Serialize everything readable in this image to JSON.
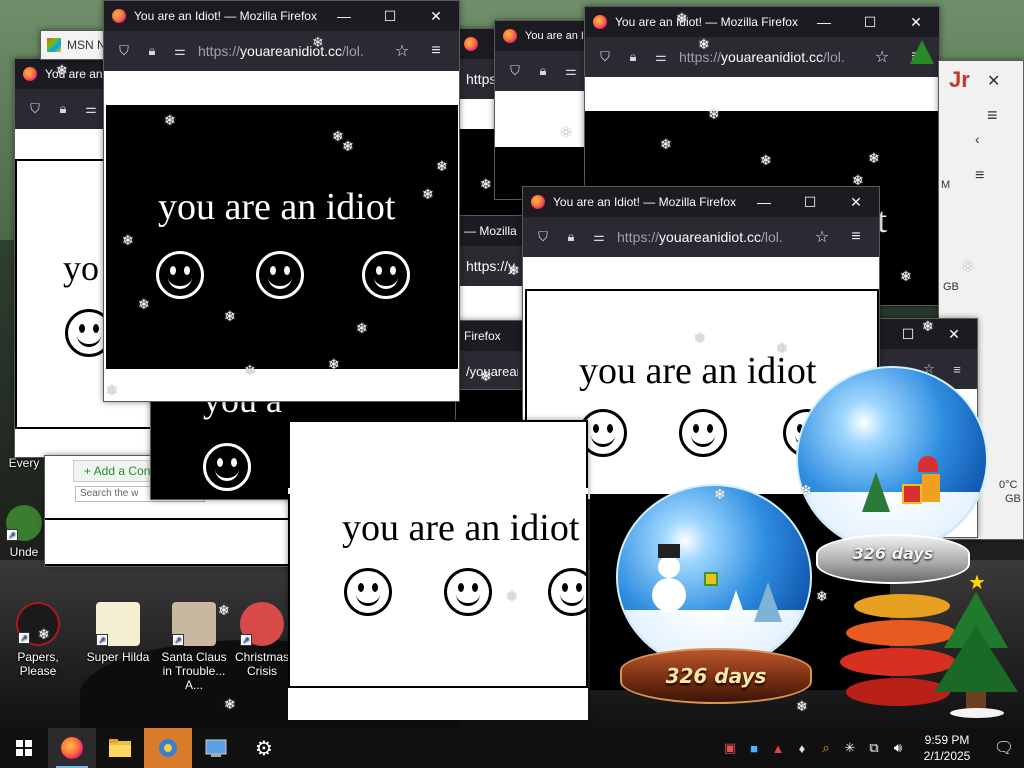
{
  "firefox_window": {
    "title": "You are an Idiot! — Mozilla Firefox",
    "url_prefix": "https://",
    "url_host": "youareanidiot.cc",
    "url_path": "/lol.",
    "minimize": "—",
    "maximize": "☐",
    "close": "✕",
    "icons": {
      "shield": "shield-icon",
      "lock": "lock-icon",
      "permissions": "permissions-icon",
      "star": "bookmark-star-icon",
      "menu": "hamburger-menu-icon"
    }
  },
  "page_content": {
    "headline": "you are an idiot",
    "headline_partial_1": "you a",
    "headline_partial_2": "yo",
    "headline_partial_3": "you are an idiot",
    "smiley": "smiley-face"
  },
  "partial_windows": {
    "tab_mozilla": "— Mozilla",
    "url_short_1": "https://yo",
    "url_short_2": "https://y",
    "url_short_3": "/youareanidioc",
    "title_firefox": "Firefox",
    "title_partial_left": "You are an Id",
    "msn_tab": "MSN N",
    "extra_text_1": "Jr",
    "extra_text_2": "M",
    "extra_text_3": "GB",
    "weather_temp": "0°C",
    "weather_gb": "GB",
    "add_contact": "+ Add a Cont",
    "search_partial": "Search the w",
    "every_label": "Every"
  },
  "snow_globes": [
    {
      "label": "326 days"
    },
    {
      "label": "326 days"
    }
  ],
  "desktop_icons": [
    {
      "label": "Papers, Please"
    },
    {
      "label": "Super Hilda"
    },
    {
      "label": "Santa Claus in Trouble... A..."
    },
    {
      "label": "Christmas Crisis"
    },
    {
      "label": "Unde"
    }
  ],
  "taskbar": {
    "start": "windows-start-icon",
    "apps": [
      "firefox-icon",
      "file-explorer-icon",
      "app-icon",
      "control-panel-icon",
      "settings-gear-icon"
    ],
    "time": "9:59 PM",
    "date": "2/1/2025",
    "tray": [
      "tray-app-icon-1",
      "tray-app-icon-2",
      "tray-app-icon-3",
      "tray-app-icon-4",
      "tray-search-icon",
      "tray-snowflake-icon",
      "network-icon",
      "volume-icon"
    ]
  },
  "colors": {
    "firefox_titlebar": "#1c1b22",
    "firefox_toolbar": "#2b2a33",
    "taskbar": "#101010",
    "accent": "#76b9ed",
    "globe_blue": "#2f8ee0"
  }
}
